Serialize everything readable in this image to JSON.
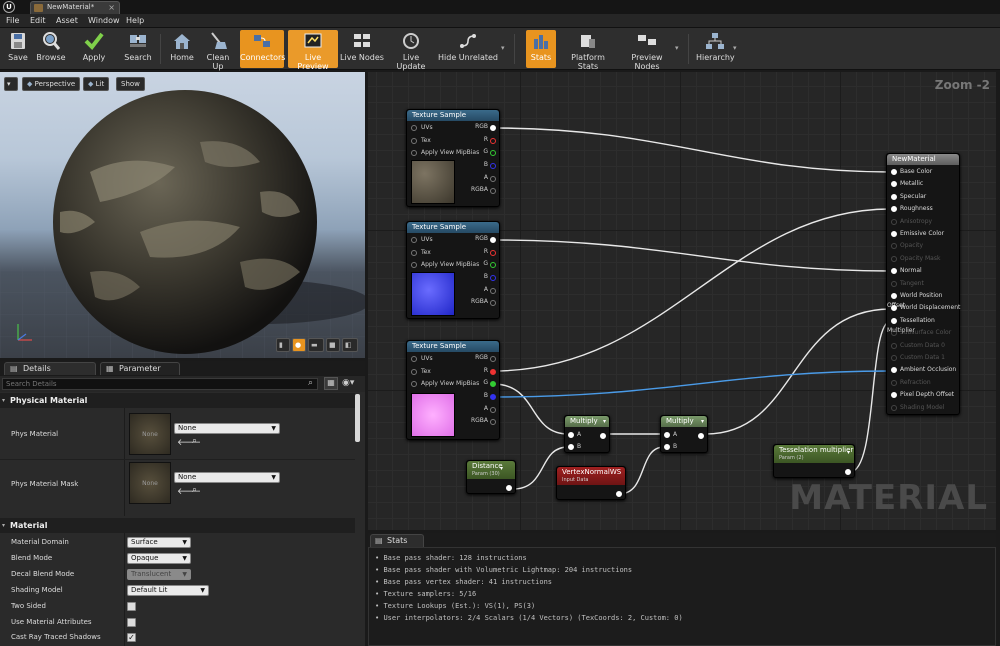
{
  "window": {
    "tab_title": "NewMaterial*",
    "logo": "U"
  },
  "menu": [
    "File",
    "Edit",
    "Asset",
    "Window",
    "Help"
  ],
  "toolbar": [
    {
      "label": "Save",
      "icon": "save-icon"
    },
    {
      "label": "Browse",
      "icon": "browse-icon"
    },
    {
      "label": "Apply",
      "icon": "apply-icon"
    },
    {
      "label": "Search",
      "icon": "search-icon"
    },
    {
      "label": "Home",
      "icon": "home-icon"
    },
    {
      "label": "Clean Up",
      "icon": "clean-up-icon"
    },
    {
      "label": "Connectors",
      "icon": "connectors-icon",
      "active": true
    },
    {
      "label": "Live Preview",
      "icon": "live-preview-icon",
      "active": true
    },
    {
      "label": "Live Nodes",
      "icon": "live-nodes-icon"
    },
    {
      "label": "Live Update",
      "icon": "live-update-icon"
    },
    {
      "label": "Hide Unrelated",
      "icon": "hide-unrelated-icon"
    },
    {
      "label": "Stats",
      "icon": "stats-icon",
      "active": true
    },
    {
      "label": "Platform Stats",
      "icon": "platform-stats-icon"
    },
    {
      "label": "Preview Nodes",
      "icon": "preview-nodes-icon"
    },
    {
      "label": "Hierarchy",
      "icon": "hierarchy-icon"
    }
  ],
  "viewport": {
    "perspective": "Perspective",
    "lit": "Lit",
    "show": "Show"
  },
  "panels": {
    "details_tab": "Details",
    "params_tab": "Parameter Defaults",
    "search_placeholder": "Search Details"
  },
  "physical_material": {
    "header": "Physical Material",
    "phys_material_label": "Phys Material",
    "phys_material_value": "None",
    "phys_material_thumb": "None",
    "phys_material_mask_label": "Phys Material Mask",
    "phys_material_mask_value": "None",
    "phys_material_mask_thumb": "None"
  },
  "material": {
    "header": "Material",
    "props": [
      {
        "label": "Material Domain",
        "value": "Surface",
        "type": "combo"
      },
      {
        "label": "Blend Mode",
        "value": "Opaque",
        "type": "combo"
      },
      {
        "label": "Decal Blend Mode",
        "value": "Translucent",
        "type": "combo-disabled"
      },
      {
        "label": "Shading Model",
        "value": "Default Lit",
        "type": "combo"
      },
      {
        "label": "Two Sided",
        "value": "",
        "type": "check"
      },
      {
        "label": "Use Material Attributes",
        "value": "",
        "type": "check"
      },
      {
        "label": "Cast Ray Traced Shadows",
        "value": "✓",
        "type": "check"
      }
    ]
  },
  "graph": {
    "zoom": "Zoom -2",
    "watermark": "MATERIAL",
    "texture_sample_title": "Texture Sample",
    "ts_inputs": [
      "UVs",
      "Tex",
      "Apply View MipBias"
    ],
    "ts_outputs": [
      "RGB",
      "R",
      "G",
      "B",
      "A",
      "RGBA"
    ],
    "multiply_title": "Multiply",
    "multiply_inputs": [
      "A",
      "B"
    ],
    "distance_title": "Distance",
    "distance_sub": "Param (30)",
    "vnws_title": "VertexNormalWS",
    "vnws_sub": "Input Data",
    "tess_title": "Tesselation multiplier",
    "tess_sub": "Param (2)",
    "result_title": "NewMaterial",
    "result_pins": [
      {
        "label": "Base Color",
        "enabled": true
      },
      {
        "label": "Metallic",
        "enabled": true
      },
      {
        "label": "Specular",
        "enabled": true
      },
      {
        "label": "Roughness",
        "enabled": true
      },
      {
        "label": "Anisotropy",
        "enabled": false
      },
      {
        "label": "Emissive Color",
        "enabled": true
      },
      {
        "label": "Opacity",
        "enabled": false
      },
      {
        "label": "Opacity Mask",
        "enabled": false
      },
      {
        "label": "Normal",
        "enabled": true
      },
      {
        "label": "Tangent",
        "enabled": false
      },
      {
        "label": "World Position Offset",
        "enabled": true
      },
      {
        "label": "World Displacement",
        "enabled": true
      },
      {
        "label": "Tessellation Multiplier",
        "enabled": true
      },
      {
        "label": "Subsurface Color",
        "enabled": false
      },
      {
        "label": "Custom Data 0",
        "enabled": false
      },
      {
        "label": "Custom Data 1",
        "enabled": false
      },
      {
        "label": "Ambient Occlusion",
        "enabled": true
      },
      {
        "label": "Refraction",
        "enabled": false
      },
      {
        "label": "Pixel Depth Offset",
        "enabled": true
      },
      {
        "label": "Shading Model",
        "enabled": false
      }
    ]
  },
  "stats": {
    "tab": "Stats",
    "lines": [
      "Base pass shader: 128 instructions",
      "Base pass shader with Volumetric Lightmap: 204 instructions",
      "Base pass vertex shader: 41 instructions",
      "Texture samplers: 5/16",
      "Texture Lookups (Est.): VS(1), PS(3)",
      "User interpolators: 2/4 Scalars (1/4 Vectors) (TexCoords: 2, Custom: 0)"
    ]
  }
}
